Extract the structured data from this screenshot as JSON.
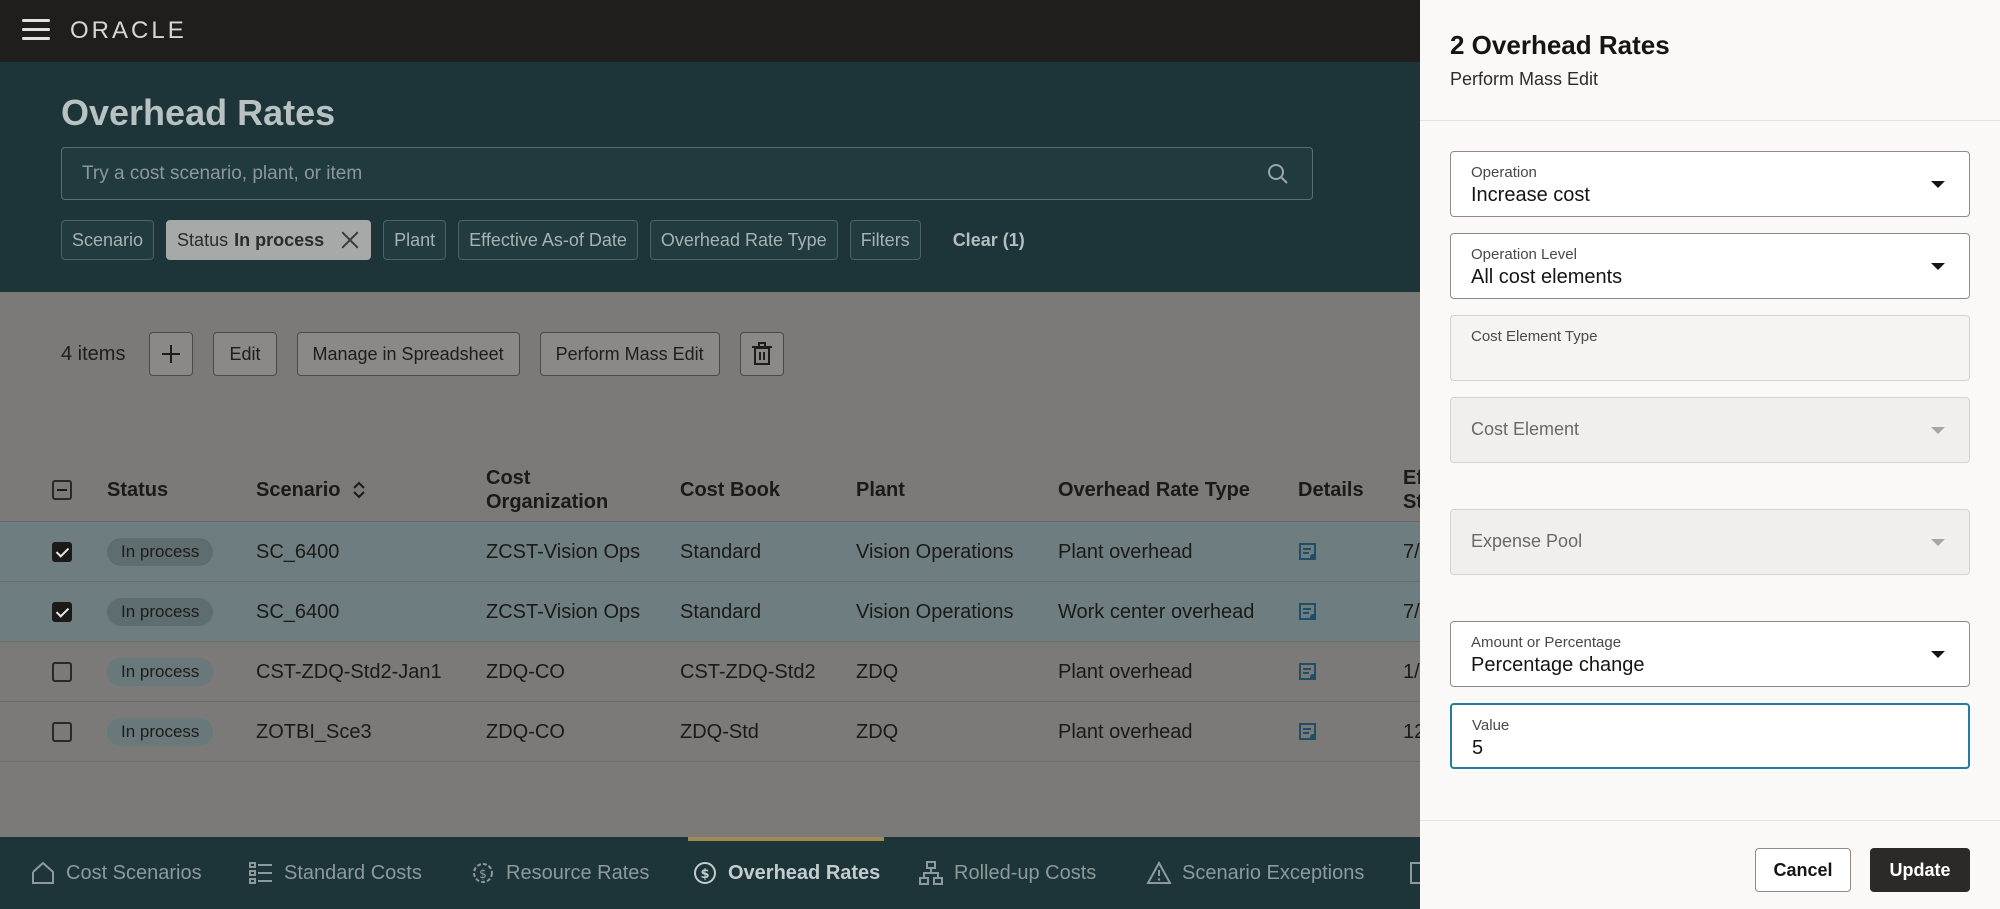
{
  "brand": {
    "logo_text": "ORACLE"
  },
  "page": {
    "title": "Overhead Rates",
    "search_placeholder": "Try a cost scenario, plant, or item"
  },
  "filters": {
    "scenario": "Scenario",
    "status_label": "Status",
    "status_value": "In process",
    "plant": "Plant",
    "effective_date": "Effective As-of Date",
    "rate_type": "Overhead Rate Type",
    "filters": "Filters",
    "clear": "Clear (1)"
  },
  "toolbar": {
    "items_count": "4 items",
    "edit": "Edit",
    "manage_spreadsheet": "Manage in Spreadsheet",
    "mass_edit": "Perform Mass Edit"
  },
  "table": {
    "columns": {
      "status": "Status",
      "scenario": "Scenario",
      "cost_org_line1": "Cost",
      "cost_org_line2": "Organization",
      "cost_book": "Cost Book",
      "plant": "Plant",
      "rate_type": "Overhead Rate Type",
      "details": "Details",
      "eff_line1": "Ef",
      "eff_line2": "St"
    },
    "rows": [
      {
        "checked": true,
        "status": "In process",
        "scenario": "SC_6400",
        "cost_org": "ZCST-Vision Ops",
        "cost_book": "Standard",
        "plant": "Vision Operations",
        "rate_type": "Plant overhead",
        "eff": "7/"
      },
      {
        "checked": true,
        "status": "In process",
        "scenario": "SC_6400",
        "cost_org": "ZCST-Vision Ops",
        "cost_book": "Standard",
        "plant": "Vision Operations",
        "rate_type": "Work center overhead",
        "eff": "7/"
      },
      {
        "checked": false,
        "status": "In process",
        "scenario": "CST-ZDQ-Std2-Jan1",
        "cost_org": "ZDQ-CO",
        "cost_book": "CST-ZDQ-Std2",
        "plant": "ZDQ",
        "rate_type": "Plant overhead",
        "eff": "1/"
      },
      {
        "checked": false,
        "status": "In process",
        "scenario": "ZOTBI_Sce3",
        "cost_org": "ZDQ-CO",
        "cost_book": "ZDQ-Std",
        "plant": "ZDQ",
        "rate_type": "Plant overhead",
        "eff": "12"
      }
    ]
  },
  "bottom_nav": {
    "cost_scenarios": "Cost Scenarios",
    "standard_costs": "Standard Costs",
    "resource_rates": "Resource Rates",
    "overhead_rates": "Overhead Rates",
    "rolled_up_costs": "Rolled-up Costs",
    "scenario_exceptions": "Scenario Exceptions"
  },
  "drawer": {
    "title": "2 Overhead Rates",
    "subtitle": "Perform Mass Edit",
    "operation_label": "Operation",
    "operation_value": "Increase cost",
    "operation_level_label": "Operation Level",
    "operation_level_value": "All cost elements",
    "cost_element_type_label": "Cost Element Type",
    "cost_element_label": "Cost Element",
    "expense_pool_label": "Expense Pool",
    "amount_pct_label": "Amount or Percentage",
    "amount_pct_value": "Percentage change",
    "value_label": "Value",
    "value_value": "5",
    "cancel": "Cancel",
    "update": "Update"
  },
  "colors": {
    "accent_focus": "#227e9e",
    "header_dark": "#201e1c",
    "hero_teal": "#1d3538",
    "nav_active_bar": "#9e8a55"
  }
}
